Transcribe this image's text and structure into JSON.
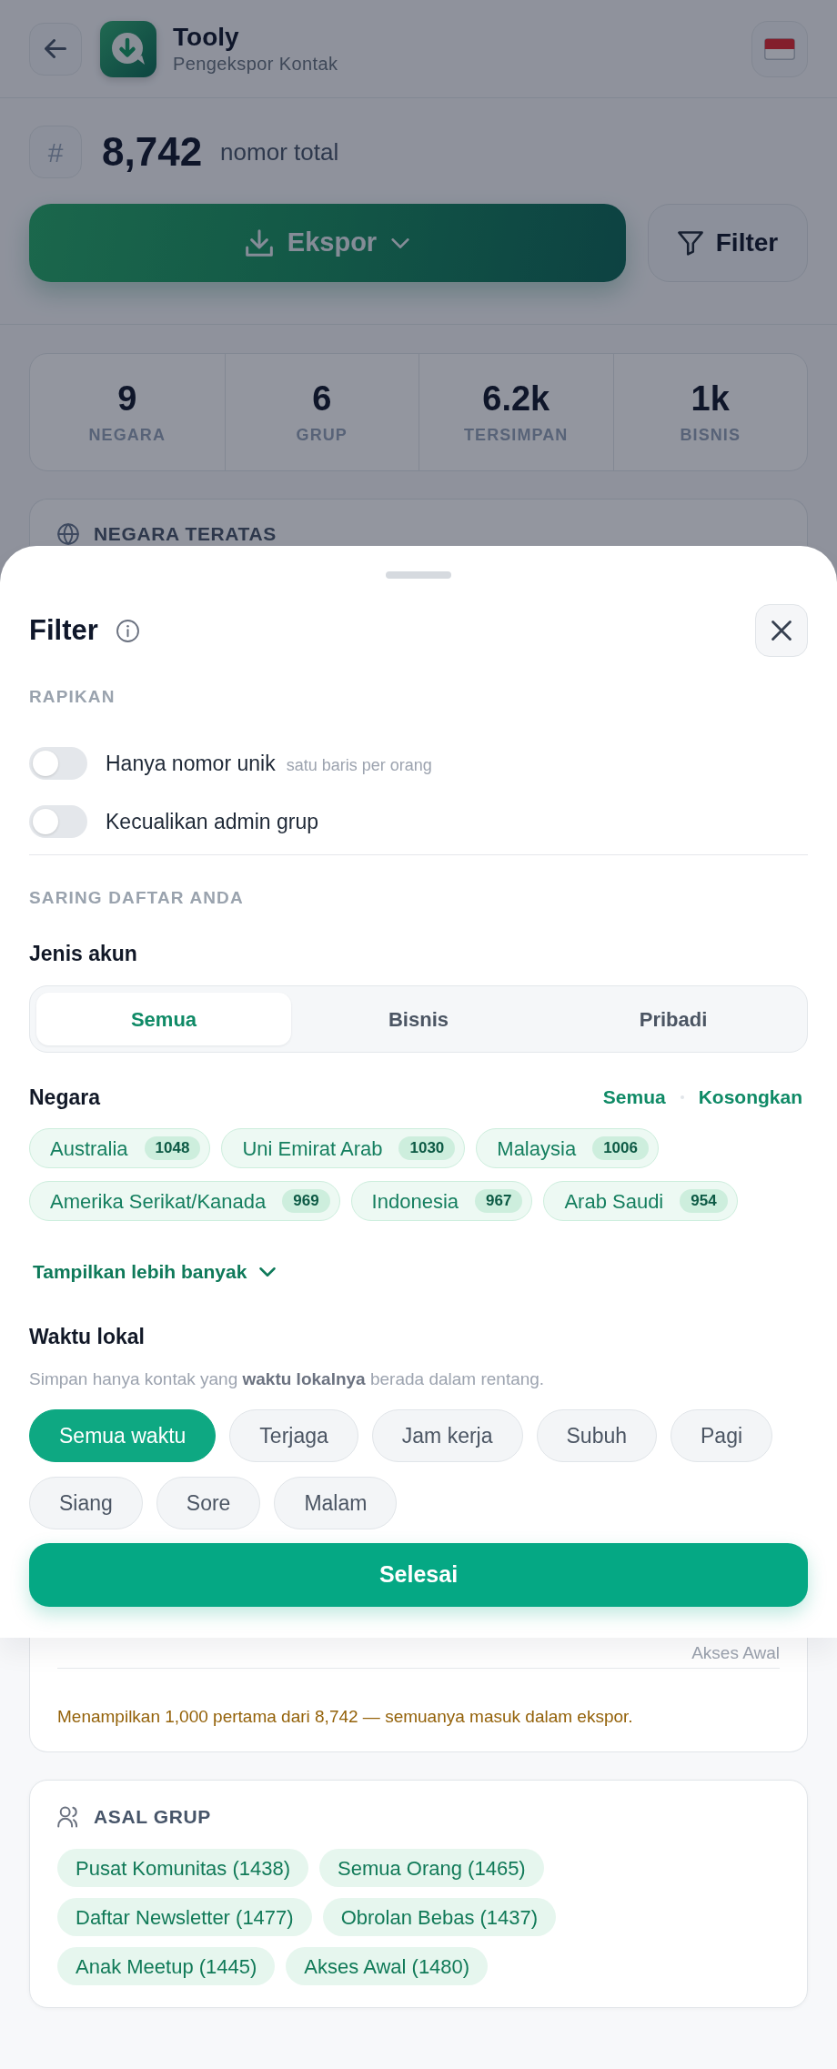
{
  "header": {
    "title": "Tooly",
    "subtitle": "Pengekspor Kontak"
  },
  "summary": {
    "symbol": "#",
    "total": "8,742",
    "label": "nomor total"
  },
  "actions": [
    {
      "kind": "export",
      "label": "Ekspor"
    },
    {
      "kind": "filter",
      "label": "Filter"
    }
  ],
  "stats": [
    {
      "value": "9",
      "label": "NEGARA"
    },
    {
      "value": "6",
      "label": "GRUP"
    },
    {
      "value": "6.2k",
      "label": "TERSIMPAN"
    },
    {
      "value": "1k",
      "label": "BISNIS"
    }
  ],
  "top_countries": {
    "title": "NEGARA TERATAS"
  },
  "filter_sheet": {
    "title": "Filter",
    "tidy": {
      "heading": "RAPIKAN",
      "toggles": [
        {
          "label": "Hanya nomor unik",
          "hint": "satu baris per orang",
          "on": false
        },
        {
          "label": "Kecualikan admin grup",
          "on": false
        }
      ]
    },
    "narrow": {
      "heading": "SARING DAFTAR ANDA",
      "account_type": {
        "label": "Jenis akun",
        "options": [
          {
            "label": "Semua",
            "selected": true
          },
          {
            "label": "Bisnis",
            "selected": false
          },
          {
            "label": "Pribadi",
            "selected": false
          }
        ]
      },
      "countries": {
        "label": "Negara",
        "links": [
          "Semua",
          "Kosongkan"
        ],
        "chips": [
          {
            "name": "Australia",
            "count": "1048"
          },
          {
            "name": "Uni Emirat Arab",
            "count": "1030"
          },
          {
            "name": "Malaysia",
            "count": "1006"
          },
          {
            "name": "Amerika Serikat/Kanada",
            "count": "969"
          },
          {
            "name": "Indonesia",
            "count": "967"
          },
          {
            "name": "Arab Saudi",
            "count": "954"
          }
        ],
        "show_more": "Tampilkan lebih banyak"
      },
      "local_time": {
        "label": "Waktu lokal",
        "description": "Simpan hanya kontak yang **waktu lokalnya** berada dalam rentang.",
        "options": [
          {
            "label": "Semua waktu",
            "selected": true
          },
          {
            "label": "Terjaga",
            "selected": false
          },
          {
            "label": "Jam kerja",
            "selected": false
          },
          {
            "label": "Subuh",
            "selected": false
          },
          {
            "label": "Pagi",
            "selected": false
          },
          {
            "label": "Siang",
            "selected": false
          },
          {
            "label": "Sore",
            "selected": false
          },
          {
            "label": "Malam",
            "selected": false
          }
        ]
      }
    },
    "done": "Selesai"
  },
  "contacts": {
    "rows": [
      {
        "group": "Akses Awal"
      }
    ],
    "notice": "Menampilkan 1,000 pertama dari 8,742 — semuanya masuk dalam ekspor."
  },
  "group_origins": {
    "title": "ASAL GRUP",
    "chips": [
      "Pusat Komunitas (1438)",
      "Semua Orang (1465)",
      "Daftar Newsletter (1477)",
      "Obrolan Bebas (1437)",
      "Anak Meetup (1445)",
      "Akses Awal (1480)"
    ]
  }
}
